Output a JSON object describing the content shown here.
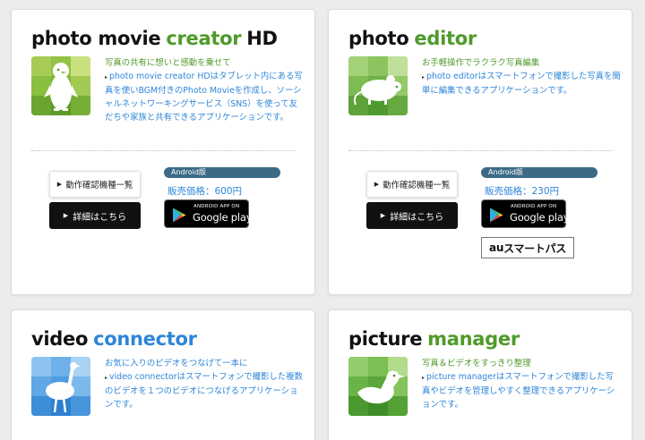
{
  "colors": {
    "green": "#4f9a2a",
    "blue": "#2e86d8",
    "background": "#ececec",
    "card": "#ffffff",
    "android_tag": "#3c6a86"
  },
  "cards": [
    {
      "title_main": "photo movie",
      "title_accent": "creator",
      "title_accent_color": "#4f9a2a",
      "title_suffix": "HD",
      "icon": "penguin-icon",
      "lead": "写真の共有に想いと感動を乗せて",
      "body": "photo movie creator HDはタブレット内にある写真を使いBGM付きのPhoto Movieを作成し、ソーシャルネットワーキングサービス（SNS）を使って友だちや家族と共有できるアプリケーションです。",
      "list_button": "動作確認機種一覧",
      "detail_button": "詳細はこちら",
      "android_tag": "Android版",
      "price": "販売価格：600円",
      "gplay_small": "ANDROID APP ON",
      "gplay_big": "Google play"
    },
    {
      "title_main": "photo",
      "title_accent": "editor",
      "title_accent_color": "#4f9a2a",
      "title_suffix": "",
      "icon": "mouse-icon",
      "lead": "お手軽操作でラクラク写真編集",
      "body": "photo editorはスマートフォンで撮影した写真を簡単に編集できるアプリケーションです。",
      "list_button": "動作確認機種一覧",
      "detail_button": "詳細はこちら",
      "android_tag": "Android版",
      "price": "販売価格：230円",
      "gplay_small": "ANDROID APP ON",
      "gplay_big": "Google play",
      "au_prefix": "au",
      "au_text": "スマートパス"
    },
    {
      "title_main": "video",
      "title_accent": "connector",
      "title_accent_color": "#2e86d8",
      "title_suffix": "",
      "icon": "ostrich-icon",
      "lead": "お気に入りのビデオをつなげて一本に",
      "body": "video connectorはスマートフォンで撮影した複数のビデオを１つのビデオにつなげるアプリケーションです。"
    },
    {
      "title_main": "picture",
      "title_accent": "manager",
      "title_accent_color": "#4f9a2a",
      "title_suffix": "",
      "icon": "duck-icon",
      "lead": "写真＆ビデオをすっきり整理",
      "body": "picture managerはスマートフォンで撮影した写真やビデオを管理しやすく整理できるアプリケーションです。"
    }
  ]
}
